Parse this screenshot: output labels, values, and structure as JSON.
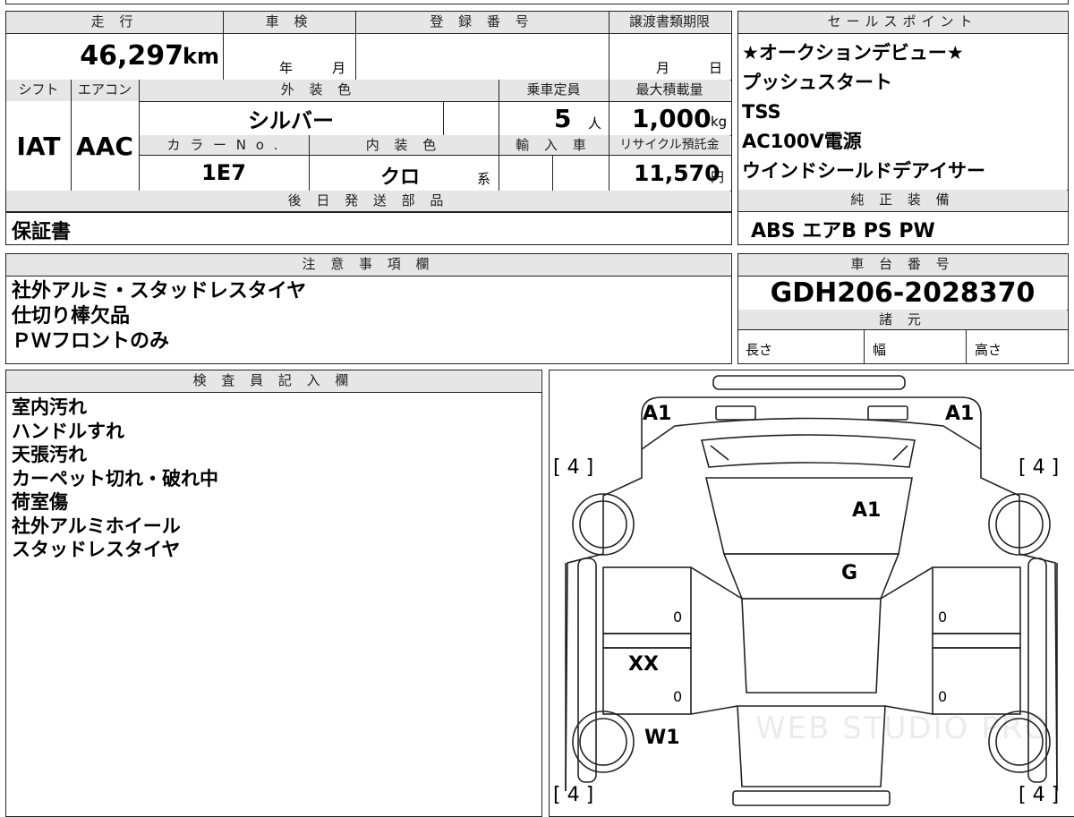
{
  "headers": {
    "mileage": "走 行",
    "inspection": "車 検",
    "registration": "登 録 番 号",
    "transfer_deadline": "譲渡書類期限",
    "sales_points": "セールスポイント",
    "shift": "シフト",
    "aircon": "エアコン",
    "exterior_color": "外 装 色",
    "capacity": "乗車定員",
    "max_load": "最大積載量",
    "color_no": "カ ラ ー N o .",
    "interior_color": "内 装 色",
    "import": "輸 入 車",
    "recycle": "リサイクル預託金",
    "later_parts": "後 日 発 送 部 品",
    "genuine_equipment": "純 正 装 備",
    "notes": "注 意 事 項 欄",
    "chassis_number": "車 台 番 号",
    "specs": "諸 元",
    "inspector": "検 査 員 記 入 欄"
  },
  "vehicle": {
    "mileage": "46,297",
    "mileage_unit": "km",
    "inspection_year_unit": "年",
    "inspection_month_unit": "月",
    "transfer_month_unit": "月",
    "transfer_day_unit": "日",
    "shift": "IAT",
    "aircon": "AAC",
    "exterior_color": "シルバー",
    "capacity": "5",
    "capacity_unit": "人",
    "max_load": "1,000",
    "max_load_unit": "kg",
    "color_no": "1E7",
    "interior_color": "クロ",
    "interior_suffix": "系",
    "recycle_fee": "11,570",
    "recycle_unit": "円",
    "later_parts": "保証書",
    "equipment": "ABS エアB PS PW",
    "chassis_number": "GDH206-2028370",
    "spec_length": "長さ",
    "spec_width": "幅",
    "spec_height": "高さ"
  },
  "sales_points": [
    "★オークションデビュー★",
    "プッシュスタート",
    "TSS",
    "AC100V電源",
    "ウインドシールドデアイサー"
  ],
  "notes": [
    "社外アルミ・スタッドレスタイヤ",
    "仕切り棒欠品",
    "ＰＷフロントのみ"
  ],
  "inspector_notes": [
    "室内汚れ",
    "ハンドルすれ",
    "天張汚れ",
    "カーペット切れ・破れ中",
    "荷室傷",
    "社外アルミホイール",
    "スタッドレスタイヤ"
  ],
  "diagram": {
    "mark_a1_left": "A1",
    "mark_a1_right": "A1",
    "mark_a1_hood": "A1",
    "mark_g": "G",
    "mark_xx": "XX",
    "mark_w1": "W1",
    "tire_tl": "[ 4 ]",
    "tire_tr": "[ 4 ]",
    "tire_bl": "[ 4 ]",
    "tire_br": "[ 4 ]",
    "zero_1": "0",
    "zero_2": "0",
    "zero_3": "0",
    "zero_4": "0",
    "watermark": "WEB STUDIO PRO"
  }
}
